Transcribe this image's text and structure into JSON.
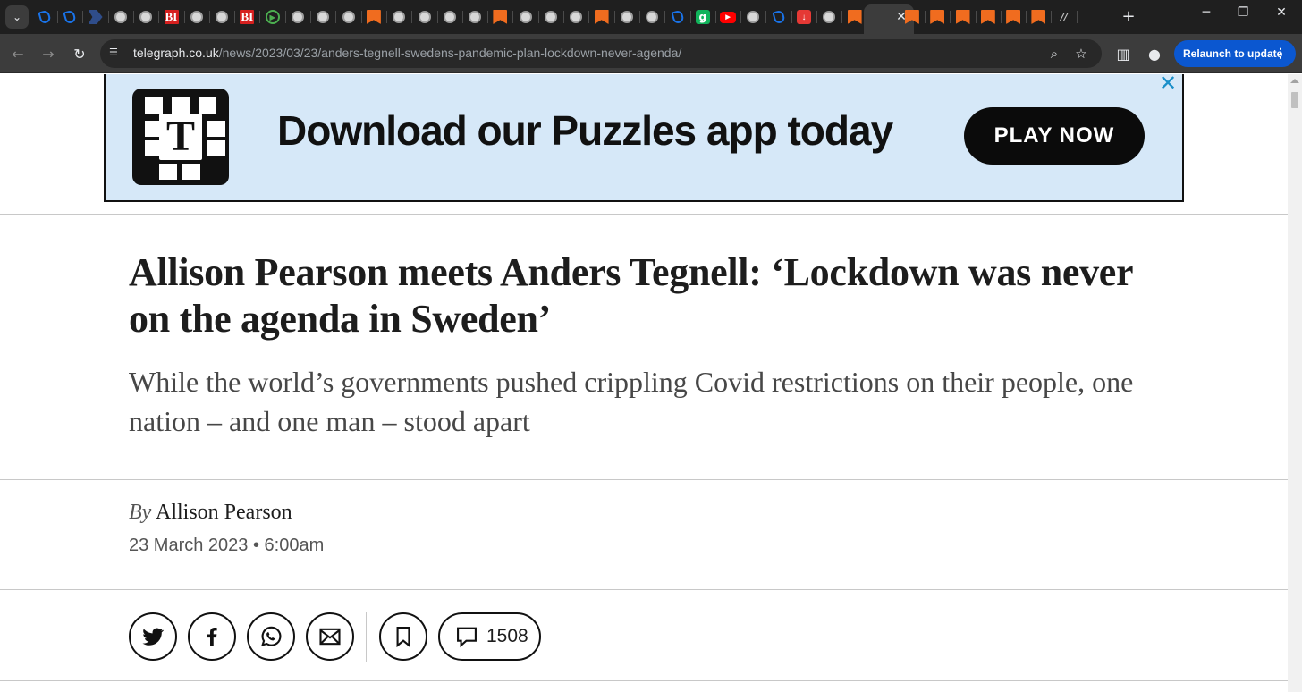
{
  "browser": {
    "address_host": "telegraph.co.uk",
    "address_path": "/news/2023/03/23/anders-tegnell-swedens-pandemic-plan-lockdown-never-agenda/",
    "relaunch_label": "Relaunch to update",
    "tab_favicons": [
      "heart",
      "heart",
      "blue-arrow",
      "globe",
      "globe",
      "bi",
      "globe",
      "globe",
      "bi",
      "play",
      "globe",
      "globe",
      "globe",
      "bookmark",
      "globe",
      "globe",
      "globe",
      "globe",
      "bookmark",
      "globe",
      "globe",
      "globe",
      "bookmark",
      "globe",
      "globe",
      "heart",
      "g",
      "youtube",
      "globe",
      "heart",
      "red",
      "globe",
      "bookmark"
    ],
    "tab_favicons_after_active": [
      "bookmark",
      "bookmark",
      "bookmark",
      "bookmark",
      "bookmark",
      "bookmark",
      "lz"
    ]
  },
  "ad": {
    "headline": "Download our Puzzles app today",
    "cta": "PLAY NOW",
    "logo_letter": "T"
  },
  "article": {
    "headline": "Allison Pearson meets Anders Tegnell: ‘Lockdown was never on the agenda in Sweden’",
    "standfirst": "While the world’s governments pushed crippling Covid restrictions on their people, one nation – and one man – stood apart",
    "byline_prefix": "By",
    "author": "Allison Pearson",
    "date": "23 March 2023",
    "time": "6:00am",
    "comment_count": "1508"
  },
  "colors": {
    "chrome_dark": "#1f1f1f",
    "toolbar": "#3c3c3c",
    "relaunch_blue": "#0b57d0",
    "ad_background": "#d6e8f8",
    "ad_close": "#1a8fc9",
    "headline_text": "#1d1d1d"
  }
}
